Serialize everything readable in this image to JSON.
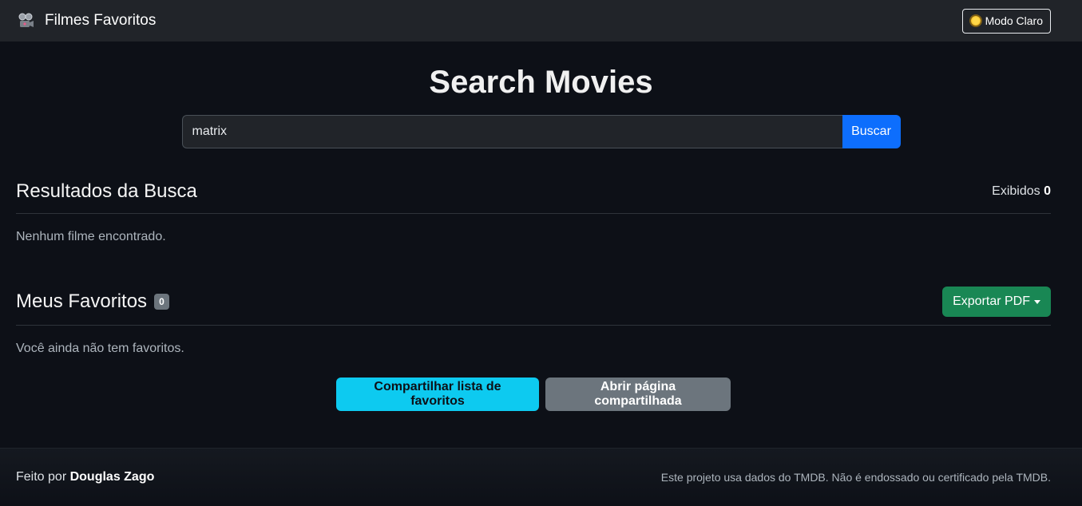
{
  "navbar": {
    "brand": "Filmes Favoritos",
    "brand_icon": "film-projector-icon",
    "theme_button": "Modo Claro",
    "theme_icon": "sun-icon"
  },
  "search": {
    "title": "Search Movies",
    "value": "matrix",
    "button": "Buscar"
  },
  "results": {
    "title": "Resultados da Busca",
    "shown_label": "Exibidos",
    "shown_count": "0",
    "empty_message": "Nenhum filme encontrado."
  },
  "favorites": {
    "title": "Meus Favoritos",
    "count": "0",
    "export_button": "Exportar PDF",
    "empty_message": "Você ainda não tem favoritos.",
    "share_button": "Compartilhar lista de favoritos",
    "open_shared_button": "Abrir página compartilhada"
  },
  "footer": {
    "made_by_prefix": "Feito por",
    "author": "Douglas Zago",
    "disclaimer": "Este projeto usa dados do TMDB. Não é endossado ou certificado pela TMDB."
  },
  "colors": {
    "background": "#0d1017",
    "navbar": "#212429",
    "primary": "#0d6efd",
    "success": "#198754",
    "info": "#0dcaf0",
    "secondary": "#6c757d"
  }
}
